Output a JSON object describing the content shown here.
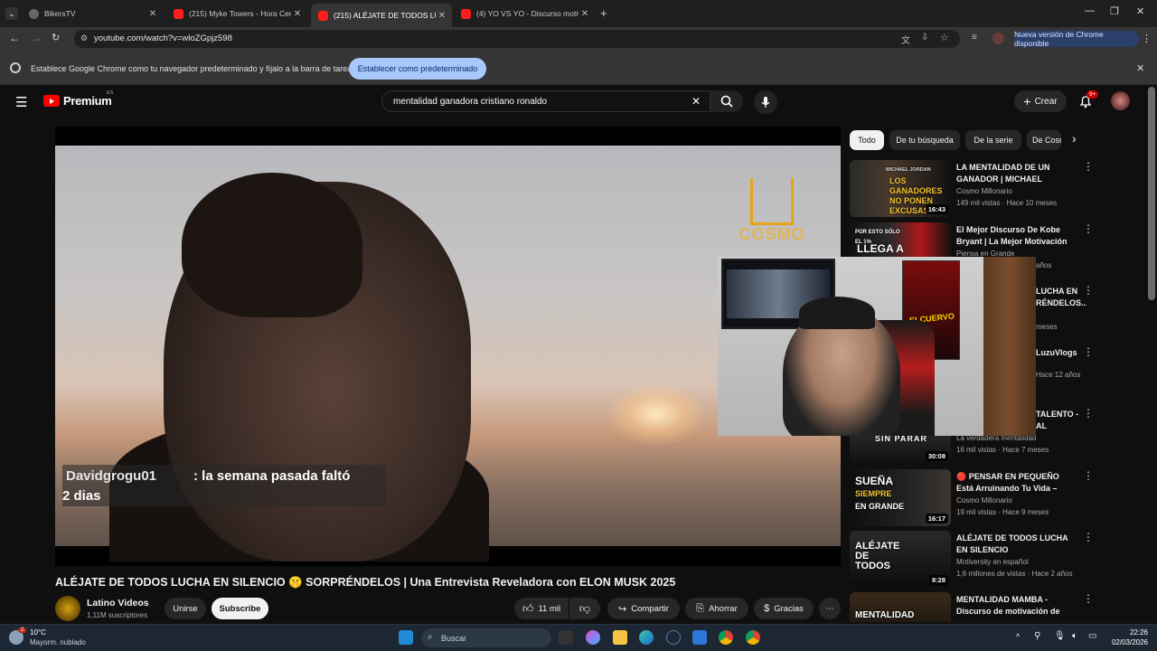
{
  "browser": {
    "tabs": [
      {
        "title": "BikersTV",
        "active": false
      },
      {
        "title": "(215) Myke Towers - Hora Cero",
        "active": false
      },
      {
        "title": "(215) ALÉJATE DE TODOS LUCHA",
        "active": true
      },
      {
        "title": "(4) YO VS YO - Discurso motiva",
        "active": false
      }
    ],
    "url": "youtube.com/watch?v=wloZGpjz598",
    "update_label": "Nueva versión de Chrome disponible",
    "infobar_text": "Establece Google Chrome como tu navegador predeterminado y fíjalo a la barra de tareas",
    "infobar_button": "Establecer como predeterminado"
  },
  "youtube": {
    "logo_text": "Premium",
    "country_code": "ES",
    "search_query": "mentalidad ganadora cristiano ronaldo",
    "create_label": "Crear",
    "notif_count": "9+"
  },
  "player": {
    "brand_overlay": "COSMO",
    "chat_user": "Davidgrogu01",
    "chat_message": ": la semana pasada faltó",
    "chat_message_2": "2 dias",
    "poster_text": "ELCUERVO"
  },
  "video": {
    "title": "ALÉJATE DE TODOS LUCHA EN SILENCIO 🤫 SORPRÉNDELOS | Una Entrevista Reveladora con ELON MUSK 2025",
    "channel": "Latino Videos",
    "subscribers": "1,11M suscriptores",
    "join_label": "Unirse",
    "subscribe_label": "Subscribe",
    "likes": "11 mil",
    "share_label": "Compartir",
    "save_label": "Ahorrar",
    "thanks_label": "Gracias"
  },
  "sidebar": {
    "chips": [
      "Todo",
      "De tu búsqueda",
      "De la serie",
      "De Cosmo"
    ],
    "items": [
      {
        "title": "LA MENTALIDAD DE UN GANADOR | MICHAEL JORDA...",
        "channel": "Cosmo Millonario",
        "meta": "149 mil vistas · Hace 10 meses",
        "duration": "16:43",
        "thumb_text": "LOS GANADORES NO PONEN EXCUSAS",
        "thumb_name": "MICHAEL JORDAN"
      },
      {
        "title": "El Mejor Discurso De Kobe Bryant | La Mejor Motivación D...",
        "channel": "Piensa en Grande",
        "meta": "años",
        "duration": "",
        "thumb_text": "LLEGA A",
        "thumb_name": "POR ESTO SÓLO EL 1%"
      },
      {
        "title": "LUCHA EN RÉNDELOS...",
        "channel": "",
        "meta": "meses",
        "duration": "",
        "thumb_text": "",
        "thumb_name": ""
      },
      {
        "title": "LuzuVlogs",
        "channel": "",
        "meta": "Hace 12 años",
        "duration": "",
        "thumb_text": "",
        "thumb_name": ""
      },
      {
        "title": "TALENTO - AL",
        "channel": "La verdadera mentalidad",
        "meta": "16 mil vistas · Hace 7 meses",
        "duration": "30:08",
        "thumb_text": "SIN PARAR",
        "thumb_name": ""
      },
      {
        "title": "🔴 PENSAR EN PEQUEÑO Está Arruinando Tu Vida – Debes ...",
        "channel": "Cosmo Millonario",
        "meta": "19 mil vistas · Hace 9 meses",
        "duration": "16:17",
        "thumb_text": "SUEÑA",
        "thumb_text2": "SIEMPRE",
        "thumb_text3": "EN GRANDE",
        "thumb_name": ""
      },
      {
        "title": "ALÉJATE DE TODOS LUCHA EN SILENCIO SORPRÉNDELOS - ...",
        "channel": "Motiversity en español",
        "meta": "1,6 millones de vistas · Hace 2 años",
        "duration": "8:28",
        "thumb_text": "ALÉJATE DE TODOS",
        "thumb_name": ""
      },
      {
        "title": "MENTALIDAD MAMBA - Discurso de motivación de Ko...",
        "channel": "",
        "meta": "",
        "duration": "",
        "thumb_text": "MENTALIDAD",
        "thumb_name": ""
      }
    ]
  },
  "taskbar": {
    "temperature": "10°C",
    "weather": "Mayorm. nublado",
    "search_label": "Buscar",
    "time": "22:26",
    "date": "02/03/2026",
    "weather_badge": "2"
  }
}
